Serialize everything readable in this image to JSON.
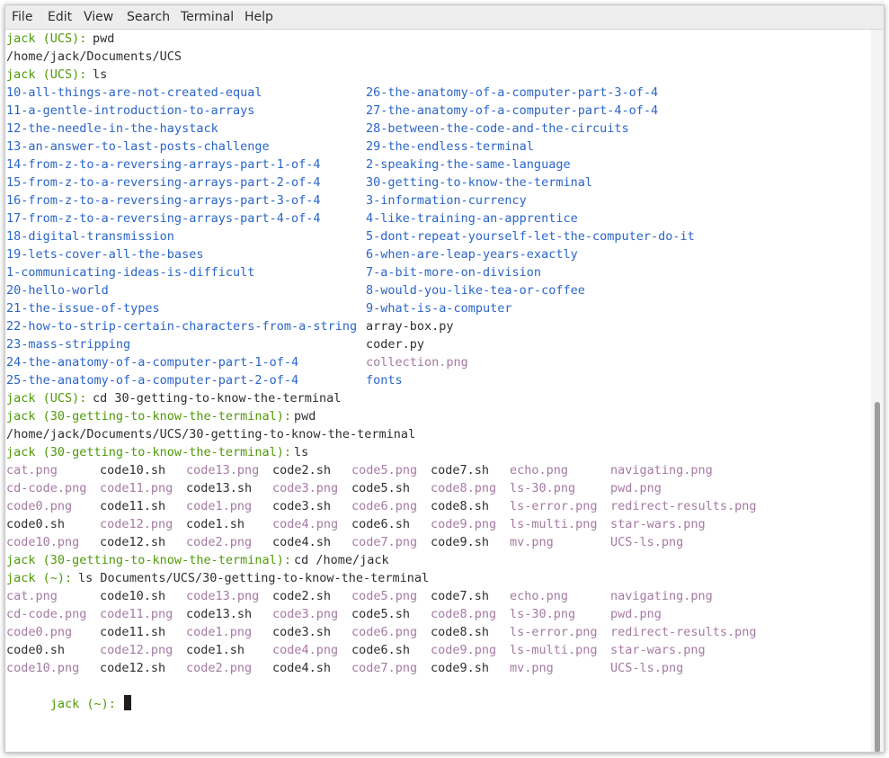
{
  "menu": [
    "File",
    "Edit",
    "View",
    "Search",
    "Terminal",
    "Help"
  ],
  "colors": {
    "prompt": "#4e9a06",
    "directory": "#2a65c9",
    "image_file": "#a57aa3",
    "text": "#2e2e2e"
  },
  "terminal": {
    "lines": [
      {
        "segments": [
          {
            "t": "jack (UCS): ",
            "c": "prompt",
            "col": 0
          },
          {
            "t": "pwd",
            "c": "plain",
            "col": 12
          }
        ]
      },
      {
        "segments": [
          {
            "t": "/home/jack/Documents/UCS",
            "c": "plain",
            "col": 0
          }
        ]
      },
      {
        "segments": [
          {
            "t": "jack (UCS): ",
            "c": "prompt",
            "col": 0
          },
          {
            "t": "ls",
            "c": "plain",
            "col": 12
          }
        ]
      },
      {
        "segments": [
          {
            "t": "10-all-things-are-not-created-equal",
            "c": "dir",
            "col": 0
          },
          {
            "t": "26-the-anatomy-of-a-computer-part-3-of-4",
            "c": "dir",
            "col": 50
          }
        ]
      },
      {
        "segments": [
          {
            "t": "11-a-gentle-introduction-to-arrays",
            "c": "dir",
            "col": 0
          },
          {
            "t": "27-the-anatomy-of-a-computer-part-4-of-4",
            "c": "dir",
            "col": 50
          }
        ]
      },
      {
        "segments": [
          {
            "t": "12-the-needle-in-the-haystack",
            "c": "dir",
            "col": 0
          },
          {
            "t": "28-between-the-code-and-the-circuits",
            "c": "dir",
            "col": 50
          }
        ]
      },
      {
        "segments": [
          {
            "t": "13-an-answer-to-last-posts-challenge",
            "c": "dir",
            "col": 0
          },
          {
            "t": "29-the-endless-terminal",
            "c": "dir",
            "col": 50
          }
        ]
      },
      {
        "segments": [
          {
            "t": "14-from-z-to-a-reversing-arrays-part-1-of-4",
            "c": "dir",
            "col": 0
          },
          {
            "t": "2-speaking-the-same-language",
            "c": "dir",
            "col": 50
          }
        ]
      },
      {
        "segments": [
          {
            "t": "15-from-z-to-a-reversing-arrays-part-2-of-4",
            "c": "dir",
            "col": 0
          },
          {
            "t": "30-getting-to-know-the-terminal",
            "c": "dir",
            "col": 50
          }
        ]
      },
      {
        "segments": [
          {
            "t": "16-from-z-to-a-reversing-arrays-part-3-of-4",
            "c": "dir",
            "col": 0
          },
          {
            "t": "3-information-currency",
            "c": "dir",
            "col": 50
          }
        ]
      },
      {
        "segments": [
          {
            "t": "17-from-z-to-a-reversing-arrays-part-4-of-4",
            "c": "dir",
            "col": 0
          },
          {
            "t": "4-like-training-an-apprentice",
            "c": "dir",
            "col": 50
          }
        ]
      },
      {
        "segments": [
          {
            "t": "18-digital-transmission",
            "c": "dir",
            "col": 0
          },
          {
            "t": "5-dont-repeat-yourself-let-the-computer-do-it",
            "c": "dir",
            "col": 50
          }
        ]
      },
      {
        "segments": [
          {
            "t": "19-lets-cover-all-the-bases",
            "c": "dir",
            "col": 0
          },
          {
            "t": "6-when-are-leap-years-exactly",
            "c": "dir",
            "col": 50
          }
        ]
      },
      {
        "segments": [
          {
            "t": "1-communicating-ideas-is-difficult",
            "c": "dir",
            "col": 0
          },
          {
            "t": "7-a-bit-more-on-division",
            "c": "dir",
            "col": 50
          }
        ]
      },
      {
        "segments": [
          {
            "t": "20-hello-world",
            "c": "dir",
            "col": 0
          },
          {
            "t": "8-would-you-like-tea-or-coffee",
            "c": "dir",
            "col": 50
          }
        ]
      },
      {
        "segments": [
          {
            "t": "21-the-issue-of-types",
            "c": "dir",
            "col": 0
          },
          {
            "t": "9-what-is-a-computer",
            "c": "dir",
            "col": 50
          }
        ]
      },
      {
        "segments": [
          {
            "t": "22-how-to-strip-certain-characters-from-a-string",
            "c": "dir",
            "col": 0
          },
          {
            "t": "array-box.py",
            "c": "plain",
            "col": 50
          }
        ]
      },
      {
        "segments": [
          {
            "t": "23-mass-stripping",
            "c": "dir",
            "col": 0
          },
          {
            "t": "coder.py",
            "c": "plain",
            "col": 50
          }
        ]
      },
      {
        "segments": [
          {
            "t": "24-the-anatomy-of-a-computer-part-1-of-4",
            "c": "dir",
            "col": 0
          },
          {
            "t": "collection.png",
            "c": "png",
            "col": 50
          }
        ]
      },
      {
        "segments": [
          {
            "t": "25-the-anatomy-of-a-computer-part-2-of-4",
            "c": "dir",
            "col": 0
          },
          {
            "t": "fonts",
            "c": "dir",
            "col": 50
          }
        ]
      },
      {
        "segments": [
          {
            "t": "jack (UCS): ",
            "c": "prompt",
            "col": 0
          },
          {
            "t": "cd 30-getting-to-know-the-terminal",
            "c": "plain",
            "col": 12
          }
        ]
      },
      {
        "segments": [
          {
            "t": "jack (30-getting-to-know-the-terminal): ",
            "c": "prompt",
            "col": 0
          },
          {
            "t": "pwd",
            "c": "plain",
            "col": 40
          }
        ]
      },
      {
        "segments": [
          {
            "t": "/home/jack/Documents/UCS/30-getting-to-know-the-terminal",
            "c": "plain",
            "col": 0
          }
        ]
      },
      {
        "segments": [
          {
            "t": "jack (30-getting-to-know-the-terminal): ",
            "c": "prompt",
            "col": 0
          },
          {
            "t": "ls",
            "c": "plain",
            "col": 40
          }
        ]
      },
      {
        "segments": [
          {
            "t": "cat.png",
            "c": "png",
            "col": 0
          },
          {
            "t": "code10.sh",
            "c": "plain",
            "col": 13
          },
          {
            "t": "code13.png",
            "c": "png",
            "col": 25
          },
          {
            "t": "code2.sh",
            "c": "plain",
            "col": 37
          },
          {
            "t": "code5.png",
            "c": "png",
            "col": 48
          },
          {
            "t": "code7.sh",
            "c": "plain",
            "col": 59
          },
          {
            "t": "echo.png",
            "c": "png",
            "col": 70
          },
          {
            "t": "navigating.png",
            "c": "png",
            "col": 84
          }
        ]
      },
      {
        "segments": [
          {
            "t": "cd-code.png",
            "c": "png",
            "col": 0
          },
          {
            "t": "code11.png",
            "c": "png",
            "col": 13
          },
          {
            "t": "code13.sh",
            "c": "plain",
            "col": 25
          },
          {
            "t": "code3.png",
            "c": "png",
            "col": 37
          },
          {
            "t": "code5.sh",
            "c": "plain",
            "col": 48
          },
          {
            "t": "code8.png",
            "c": "png",
            "col": 59
          },
          {
            "t": "ls-30.png",
            "c": "png",
            "col": 70
          },
          {
            "t": "pwd.png",
            "c": "png",
            "col": 84
          }
        ]
      },
      {
        "segments": [
          {
            "t": "code0.png",
            "c": "png",
            "col": 0
          },
          {
            "t": "code11.sh",
            "c": "plain",
            "col": 13
          },
          {
            "t": "code1.png",
            "c": "png",
            "col": 25
          },
          {
            "t": "code3.sh",
            "c": "plain",
            "col": 37
          },
          {
            "t": "code6.png",
            "c": "png",
            "col": 48
          },
          {
            "t": "code8.sh",
            "c": "plain",
            "col": 59
          },
          {
            "t": "ls-error.png",
            "c": "png",
            "col": 70
          },
          {
            "t": "redirect-results.png",
            "c": "png",
            "col": 84
          }
        ]
      },
      {
        "segments": [
          {
            "t": "code0.sh",
            "c": "plain",
            "col": 0
          },
          {
            "t": "code12.png",
            "c": "png",
            "col": 13
          },
          {
            "t": "code1.sh",
            "c": "plain",
            "col": 25
          },
          {
            "t": "code4.png",
            "c": "png",
            "col": 37
          },
          {
            "t": "code6.sh",
            "c": "plain",
            "col": 48
          },
          {
            "t": "code9.png",
            "c": "png",
            "col": 59
          },
          {
            "t": "ls-multi.png",
            "c": "png",
            "col": 70
          },
          {
            "t": "star-wars.png",
            "c": "png",
            "col": 84
          }
        ]
      },
      {
        "segments": [
          {
            "t": "code10.png",
            "c": "png",
            "col": 0
          },
          {
            "t": "code12.sh",
            "c": "plain",
            "col": 13
          },
          {
            "t": "code2.png",
            "c": "png",
            "col": 25
          },
          {
            "t": "code4.sh",
            "c": "plain",
            "col": 37
          },
          {
            "t": "code7.png",
            "c": "png",
            "col": 48
          },
          {
            "t": "code9.sh",
            "c": "plain",
            "col": 59
          },
          {
            "t": "mv.png",
            "c": "png",
            "col": 70
          },
          {
            "t": "UCS-ls.png",
            "c": "png",
            "col": 84
          }
        ]
      },
      {
        "segments": [
          {
            "t": "jack (30-getting-to-know-the-terminal): ",
            "c": "prompt",
            "col": 0
          },
          {
            "t": "cd /home/jack",
            "c": "plain",
            "col": 40
          }
        ]
      },
      {
        "segments": [
          {
            "t": "jack (~): ",
            "c": "prompt",
            "col": 0
          },
          {
            "t": "ls Documents/UCS/30-getting-to-know-the-terminal",
            "c": "plain",
            "col": 10
          }
        ]
      },
      {
        "segments": [
          {
            "t": "cat.png",
            "c": "png",
            "col": 0
          },
          {
            "t": "code10.sh",
            "c": "plain",
            "col": 13
          },
          {
            "t": "code13.png",
            "c": "png",
            "col": 25
          },
          {
            "t": "code2.sh",
            "c": "plain",
            "col": 37
          },
          {
            "t": "code5.png",
            "c": "png",
            "col": 48
          },
          {
            "t": "code7.sh",
            "c": "plain",
            "col": 59
          },
          {
            "t": "echo.png",
            "c": "png",
            "col": 70
          },
          {
            "t": "navigating.png",
            "c": "png",
            "col": 84
          }
        ]
      },
      {
        "segments": [
          {
            "t": "cd-code.png",
            "c": "png",
            "col": 0
          },
          {
            "t": "code11.png",
            "c": "png",
            "col": 13
          },
          {
            "t": "code13.sh",
            "c": "plain",
            "col": 25
          },
          {
            "t": "code3.png",
            "c": "png",
            "col": 37
          },
          {
            "t": "code5.sh",
            "c": "plain",
            "col": 48
          },
          {
            "t": "code8.png",
            "c": "png",
            "col": 59
          },
          {
            "t": "ls-30.png",
            "c": "png",
            "col": 70
          },
          {
            "t": "pwd.png",
            "c": "png",
            "col": 84
          }
        ]
      },
      {
        "segments": [
          {
            "t": "code0.png",
            "c": "png",
            "col": 0
          },
          {
            "t": "code11.sh",
            "c": "plain",
            "col": 13
          },
          {
            "t": "code1.png",
            "c": "png",
            "col": 25
          },
          {
            "t": "code3.sh",
            "c": "plain",
            "col": 37
          },
          {
            "t": "code6.png",
            "c": "png",
            "col": 48
          },
          {
            "t": "code8.sh",
            "c": "plain",
            "col": 59
          },
          {
            "t": "ls-error.png",
            "c": "png",
            "col": 70
          },
          {
            "t": "redirect-results.png",
            "c": "png",
            "col": 84
          }
        ]
      },
      {
        "segments": [
          {
            "t": "code0.sh",
            "c": "plain",
            "col": 0
          },
          {
            "t": "code12.png",
            "c": "png",
            "col": 13
          },
          {
            "t": "code1.sh",
            "c": "plain",
            "col": 25
          },
          {
            "t": "code4.png",
            "c": "png",
            "col": 37
          },
          {
            "t": "code6.sh",
            "c": "plain",
            "col": 48
          },
          {
            "t": "code9.png",
            "c": "png",
            "col": 59
          },
          {
            "t": "ls-multi.png",
            "c": "png",
            "col": 70
          },
          {
            "t": "star-wars.png",
            "c": "png",
            "col": 84
          }
        ]
      },
      {
        "segments": [
          {
            "t": "code10.png",
            "c": "png",
            "col": 0
          },
          {
            "t": "code12.sh",
            "c": "plain",
            "col": 13
          },
          {
            "t": "code2.png",
            "c": "png",
            "col": 25
          },
          {
            "t": "code4.sh",
            "c": "plain",
            "col": 37
          },
          {
            "t": "code7.png",
            "c": "png",
            "col": 48
          },
          {
            "t": "code9.sh",
            "c": "plain",
            "col": 59
          },
          {
            "t": "mv.png",
            "c": "png",
            "col": 70
          },
          {
            "t": "UCS-ls.png",
            "c": "png",
            "col": 84
          }
        ]
      }
    ],
    "current_prompt": "jack (~): "
  }
}
